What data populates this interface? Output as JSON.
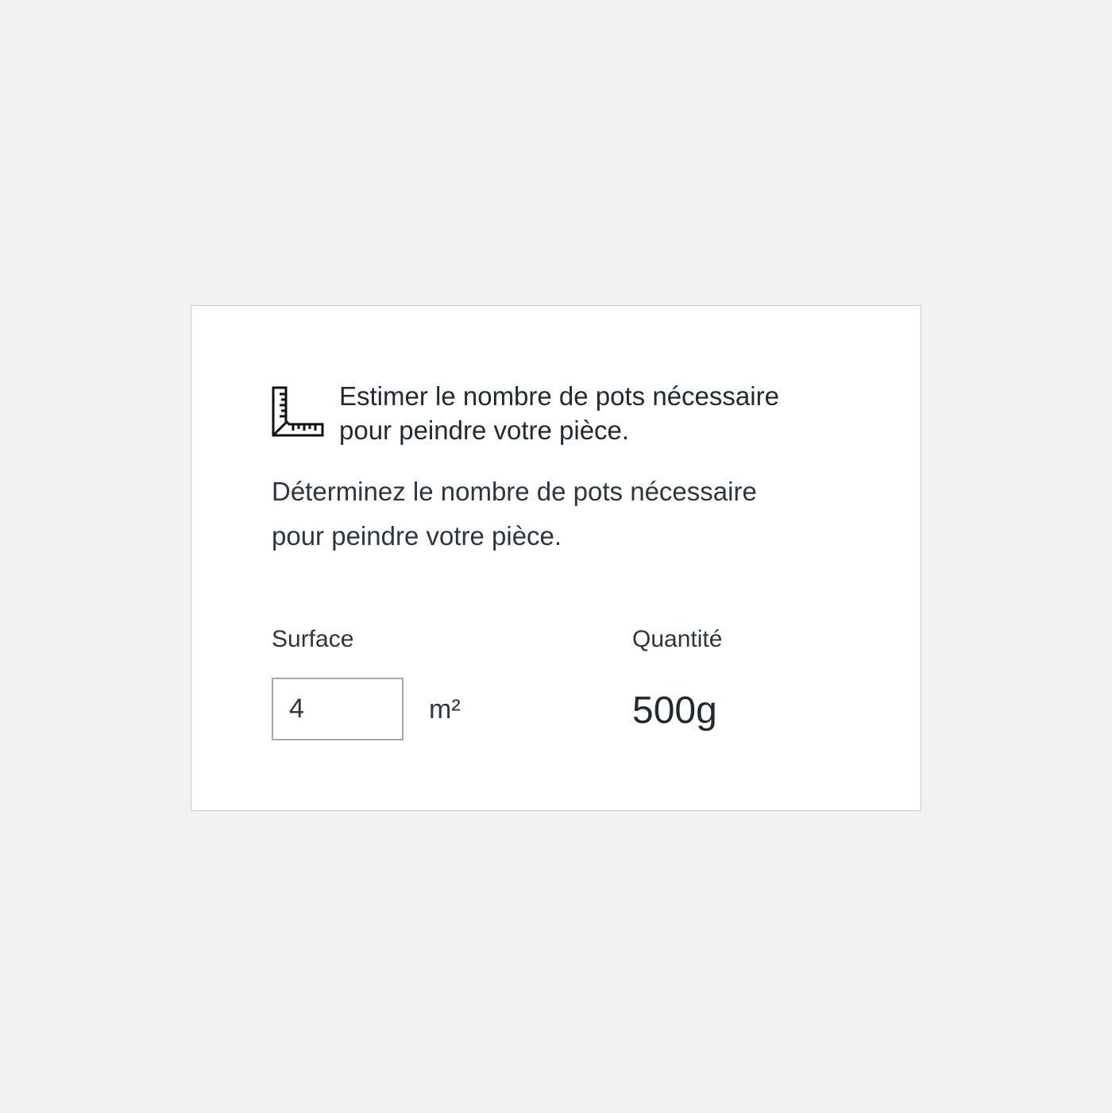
{
  "card": {
    "icon": "ruler-square-icon",
    "title": "Estimer le nombre de pots nécessaire\npour peindre votre pièce.",
    "description": "Déterminez le nombre de pots nécessaire\npour peindre votre pièce."
  },
  "surface": {
    "label": "Surface",
    "value": "4",
    "unit": "m²"
  },
  "quantity": {
    "label": "Quantité",
    "value": "500g"
  },
  "colors": {
    "background": "#f2f2f2",
    "card": "#ffffff",
    "text": "#1f2a33",
    "border": "#a8a8a8"
  }
}
